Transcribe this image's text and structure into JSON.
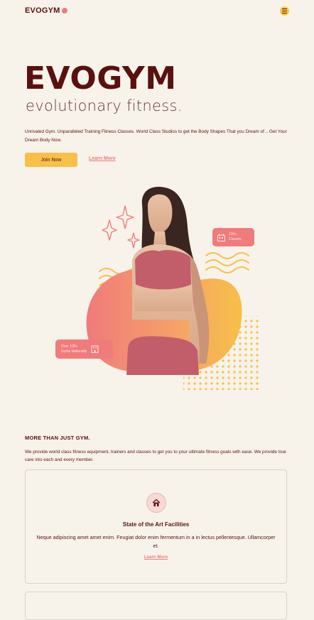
{
  "nav": {
    "logo": "EVOGYM",
    "menu_icon": "hamburger-menu-icon"
  },
  "hero": {
    "title": "EVOGYM",
    "subtitle": "evolutionary fitness.",
    "description": "Unrivaled Gym. Unparalleled Training Fitness Classes. World Class Studios to get the Body Shapes That you Dream of .. Get Your Dream Body Now.",
    "join_label": "Join Now",
    "learn_label": "Learn More"
  },
  "badges": {
    "classes_line1": "100+",
    "classes_line2": "Classes",
    "gyms_line1": "Over 100+",
    "gyms_line2": "Gyms Nationally"
  },
  "benefits": {
    "title": "MORE THAN JUST GYM.",
    "description": "We provide world class fitness equipment, trainers and classes to get you to your ultimate fitness goals with ease. We provide true care into each and every member.",
    "cards": [
      {
        "icon": "home-icon",
        "title": "State of the Art Facilities",
        "text": "Neque adipiscing amet amet enim. Feugiat dolor enim fermentum in a in lectus pellentesque. Ullamcorper et.",
        "link": "Learn More"
      }
    ]
  },
  "colors": {
    "primary": "#5b1010",
    "accent_pink": "#f07b7b",
    "accent_yellow": "#f7c048",
    "background": "#f7f3ea"
  }
}
